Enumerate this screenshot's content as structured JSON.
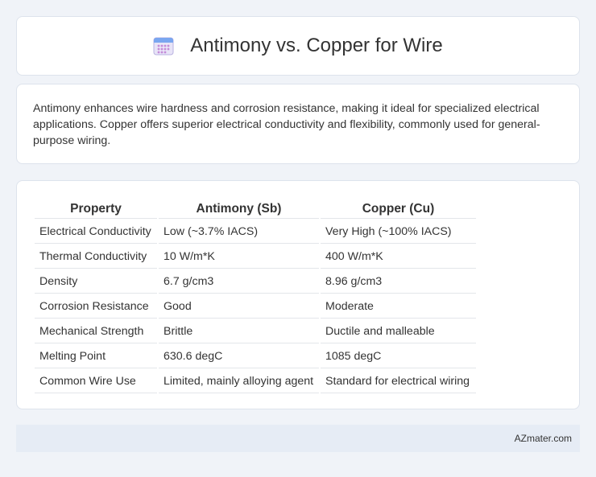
{
  "header": {
    "title": "Antimony vs. Copper for Wire",
    "icon": "calendar-icon"
  },
  "intro": {
    "text": "Antimony enhances wire hardness and corrosion resistance, making it ideal for specialized electrical applications. Copper offers superior electrical conductivity and flexibility, commonly used for general-purpose wiring."
  },
  "table": {
    "headers": [
      "Property",
      "Antimony (Sb)",
      "Copper (Cu)"
    ],
    "rows": [
      [
        "Electrical Conductivity",
        "Low (~3.7% IACS)",
        "Very High (~100% IACS)"
      ],
      [
        "Thermal Conductivity",
        "10 W/m*K",
        "400 W/m*K"
      ],
      [
        "Density",
        "6.7 g/cm3",
        "8.96 g/cm3"
      ],
      [
        "Corrosion Resistance",
        "Good",
        "Moderate"
      ],
      [
        "Mechanical Strength",
        "Brittle",
        "Ductile and malleable"
      ],
      [
        "Melting Point",
        "630.6 degC",
        "1085 degC"
      ],
      [
        "Common Wire Use",
        "Limited, mainly alloying agent",
        "Standard for electrical wiring"
      ]
    ]
  },
  "footer": {
    "brand": "AZmater.com"
  }
}
